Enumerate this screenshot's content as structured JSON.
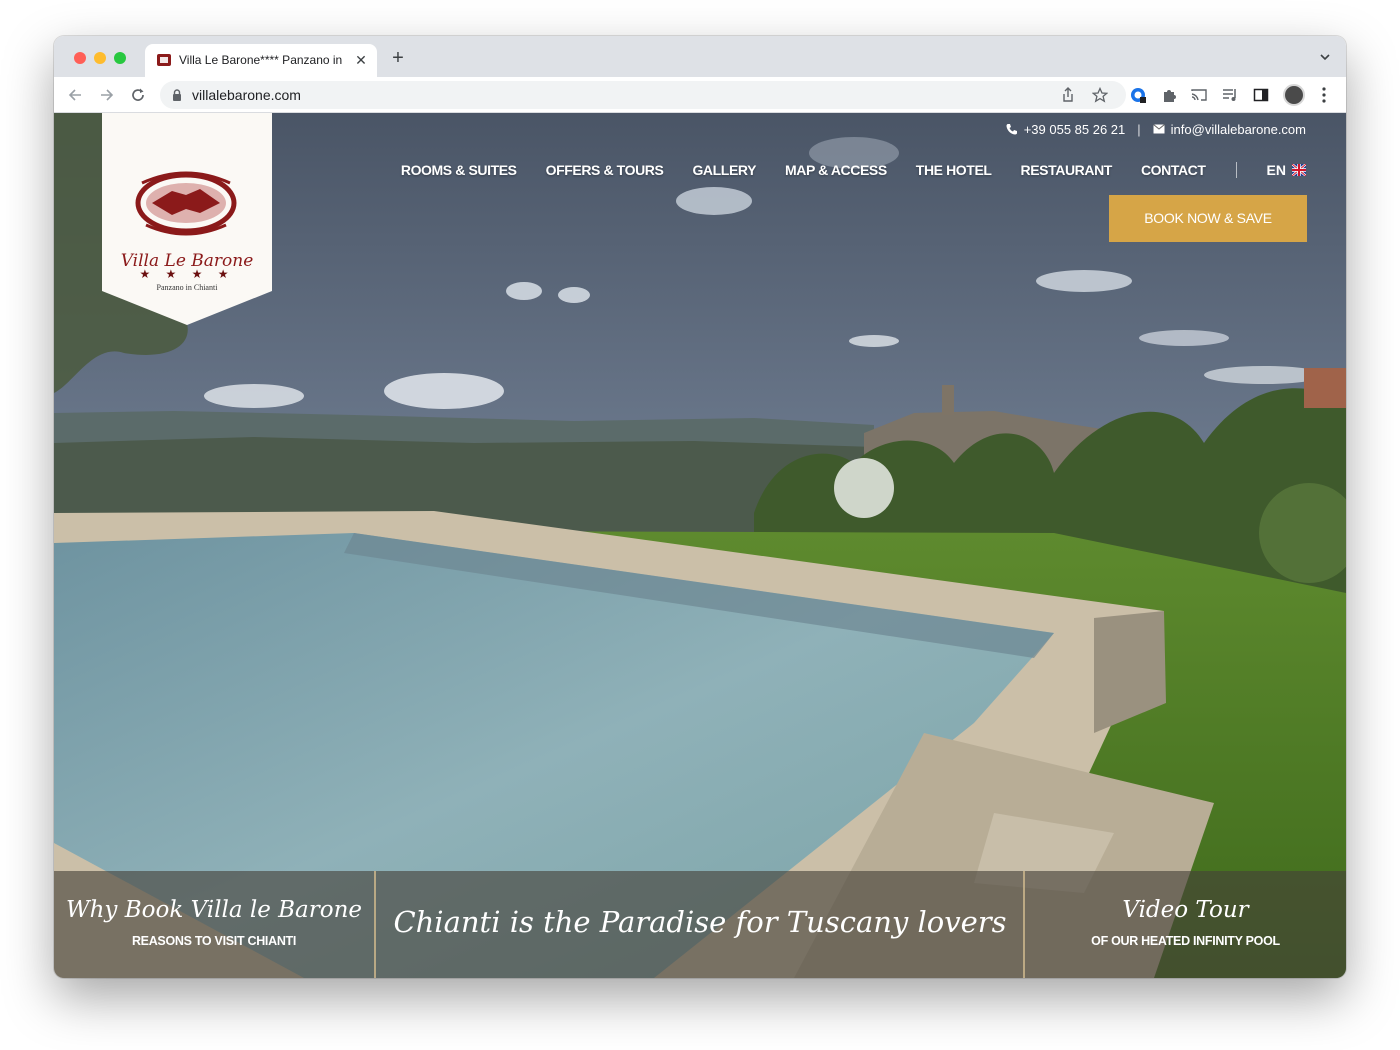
{
  "browser": {
    "tab_title": "Villa Le Barone**** Panzano in",
    "url": "villalebarone.com"
  },
  "site": {
    "logo": {
      "brand": "Villa Le Barone",
      "stars": "★ ★ ★ ★",
      "location": "Panzano in Chianti"
    },
    "contact": {
      "phone": "+39 055 85 26 21",
      "separator": "|",
      "email": "info@villalebarone.com"
    },
    "nav": [
      "ROOMS & SUITES",
      "OFFERS & TOURS",
      "GALLERY",
      "MAP & ACCESS",
      "THE HOTEL",
      "RESTAURANT",
      "CONTACT"
    ],
    "language": "EN",
    "book_button": "BOOK NOW & SAVE",
    "band": {
      "left_script": "Why Book Villa le Barone",
      "left_caps": "REASONS TO VISIT CHIANTI",
      "center_script": "Chianti is the Paradise for Tuscany lovers",
      "right_script": "Video Tour",
      "right_caps": "OF OUR HEATED INFINITY POOL"
    }
  },
  "colors": {
    "book_button": "#d6a547",
    "logo_red": "#8b1a1a",
    "band": "#464038"
  }
}
